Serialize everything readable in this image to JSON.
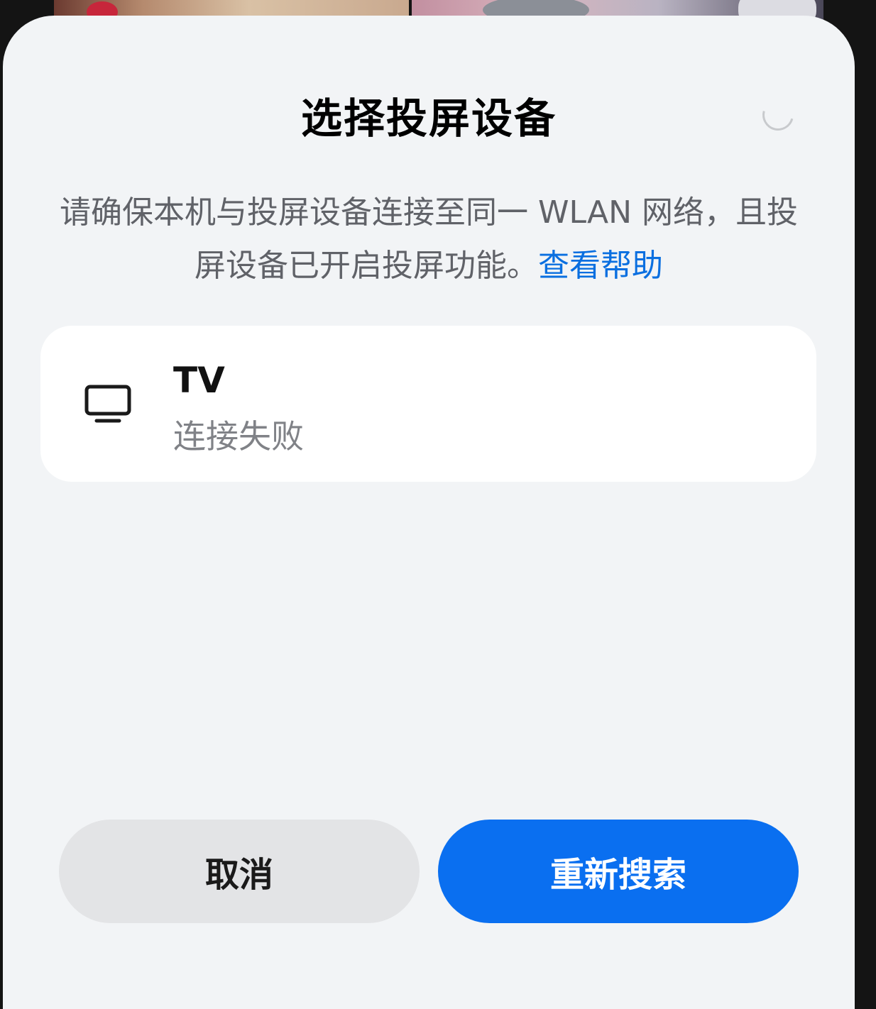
{
  "dialog": {
    "title": "选择投屏设备",
    "description": "请确保本机与投屏设备连接至同一 WLAN 网络，且投屏设备已开启投屏功能。",
    "help_link": "查看帮助",
    "loading_icon": "spinner-icon"
  },
  "devices": [
    {
      "icon": "tv-icon",
      "name": "TV",
      "status": "连接失败"
    }
  ],
  "buttons": {
    "cancel_label": "取消",
    "research_label": "重新搜索"
  },
  "colors": {
    "accent": "#0a6ff0",
    "link": "#0a6fe0",
    "sheet_background": "#f2f4f6",
    "card_background": "#ffffff",
    "cancel_button": "#e3e4e6"
  }
}
